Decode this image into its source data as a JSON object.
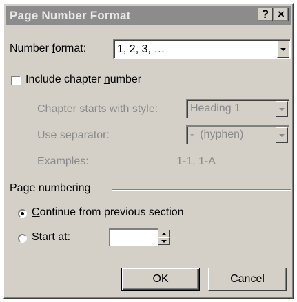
{
  "dialog": {
    "title": "Page Number Format",
    "help_glyph": "?",
    "close_glyph": "×"
  },
  "number_format": {
    "label_prefix": "Number ",
    "label_underlined": "f",
    "label_suffix": "ormat:",
    "value": "1, 2, 3, …"
  },
  "chapter": {
    "checkbox_prefix": "Include chapter ",
    "checkbox_underlined": "n",
    "checkbox_suffix": "umber",
    "checked": false,
    "starts_with_style_label": "Chapter starts with style:",
    "starts_with_style_value": "Heading 1",
    "separator_label": "Use separator:",
    "separator_value": "-  (hyphen)",
    "examples_label": "Examples:",
    "examples_value": "1-1, 1-A"
  },
  "page_numbering": {
    "group_label": "Page numbering",
    "continue_underlined": "C",
    "continue_suffix": "ontinue from previous section",
    "continue_selected": true,
    "start_at_prefix": "Start ",
    "start_at_underlined": "a",
    "start_at_suffix": "t:",
    "start_at_selected": false,
    "start_at_value": ""
  },
  "buttons": {
    "ok": "OK",
    "cancel": "Cancel"
  },
  "icons": {
    "dropdown": "chevron-down-icon",
    "spin_up": "spin-up-icon",
    "spin_down": "spin-down-icon",
    "radio_dot": "radio-dot-icon"
  },
  "colors": {
    "dialog_bg": "#d4d0c8",
    "titlebar_bg": "#8c8c8c",
    "disabled_text": "#8a8a8a"
  }
}
